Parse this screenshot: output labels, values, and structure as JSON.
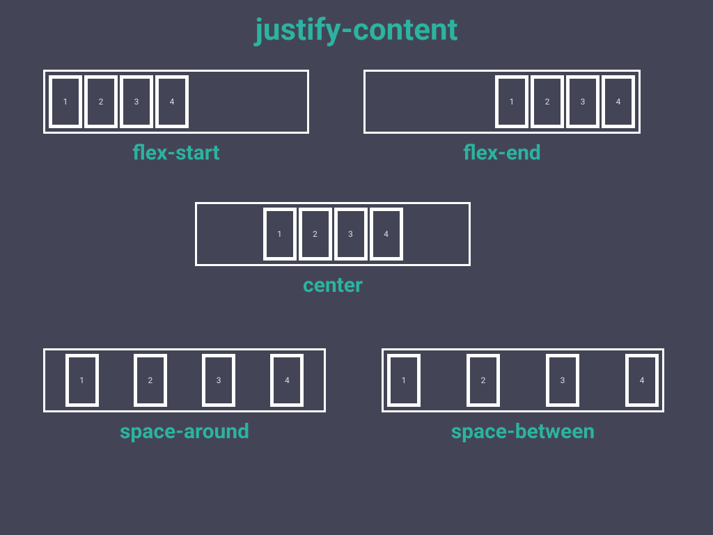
{
  "title": "justify-content",
  "examples": [
    {
      "id": "ex-flex-start",
      "mode": "flex-start",
      "label": "flex-start",
      "items": [
        "1",
        "2",
        "3",
        "4"
      ]
    },
    {
      "id": "ex-flex-end",
      "mode": "flex-end",
      "label": "flex-end",
      "items": [
        "1",
        "2",
        "3",
        "4"
      ]
    },
    {
      "id": "ex-center",
      "mode": "center",
      "label": "center",
      "items": [
        "1",
        "2",
        "3",
        "4"
      ]
    },
    {
      "id": "ex-space-around",
      "mode": "space-around",
      "label": "space-around",
      "items": [
        "1",
        "2",
        "3",
        "4"
      ]
    },
    {
      "id": "ex-space-between",
      "mode": "space-between",
      "label": "space-between",
      "items": [
        "1",
        "2",
        "3",
        "4"
      ]
    }
  ]
}
